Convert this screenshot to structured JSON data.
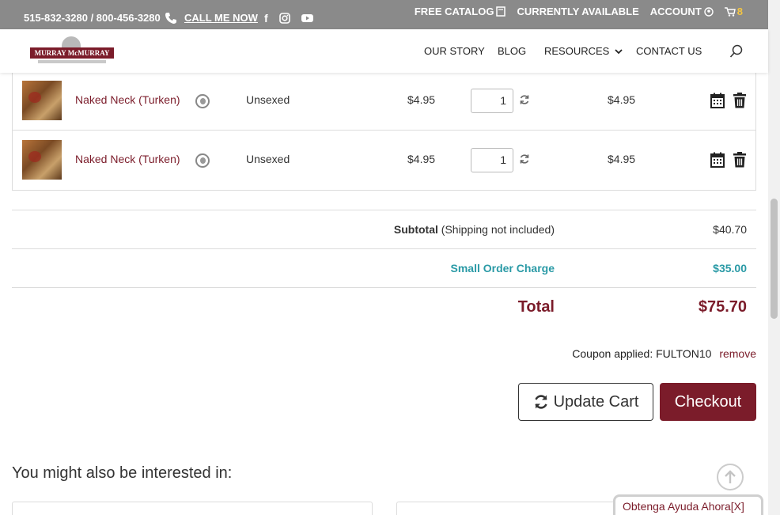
{
  "topbar": {
    "phone": "515-832-3280 / 800-456-3280",
    "call_me": "CALL ME NOW",
    "free_catalog": "FREE CATALOG",
    "currently_available": "CURRENTLY AVAILABLE",
    "account": "ACCOUNT",
    "cart_count": "8"
  },
  "header": {
    "logo_text": "MURRAY McMURRAY",
    "nav": {
      "our_story": "OUR STORY",
      "blog": "BLOG",
      "resources": "RESOURCES",
      "contact": "CONTACT US"
    }
  },
  "cart": {
    "items": [
      {
        "name": "Naked Neck (Turken)",
        "sex": "Unsexed",
        "price": "$4.95",
        "qty": "1",
        "total": "$4.95"
      },
      {
        "name": "Naked Neck (Turken)",
        "sex": "Unsexed",
        "price": "$4.95",
        "qty": "1",
        "total": "$4.95"
      }
    ]
  },
  "totals": {
    "subtotal_label": "Subtotal",
    "subtotal_note": "(Shipping not included)",
    "subtotal_value": "$40.70",
    "small_order_label": "Small Order Charge",
    "small_order_value": "$35.00",
    "total_label": "Total",
    "total_value": "$75.70"
  },
  "coupon": {
    "text": "Coupon applied: FULTON10",
    "remove": "remove"
  },
  "buttons": {
    "update_cart": "Update Cart",
    "checkout": "Checkout"
  },
  "related": {
    "heading": "You might also be interested in:"
  },
  "help_widget": {
    "label": "Obtenga Ayuda Ahora[X]"
  },
  "colors": {
    "brand": "#7b1c2a",
    "accent_teal": "#2a9aa6",
    "topbar": "#8a8a8a"
  }
}
